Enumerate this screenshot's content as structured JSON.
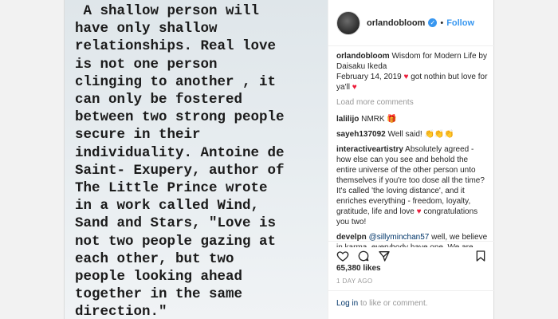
{
  "quote_lines": [
    " A shallow person will",
    "have only shallow",
    "relationships. Real love",
    "is not one person",
    "clinging to another , it",
    "can only be fostered",
    "between two strong people",
    "secure in their",
    "individuality. Antoine de",
    "Saint- Exupery, author of",
    "The Little Prince wrote",
    "in a work called Wind,",
    "Sand and Stars, \"Love is",
    "not two people gazing at",
    "each other, but two",
    "people looking ahead",
    "together in the same",
    "direction.\""
  ],
  "header": {
    "username": "orlandobloom",
    "verified_mark": "✓",
    "separator": "•",
    "follow": "Follow"
  },
  "caption": {
    "username": "orlandobloom",
    "line1": "Wisdom for Modern Life by Daisaku Ikeda",
    "line2": "February 14, 2019",
    "line2b": "got nothin but love for ya'll",
    "heart": "♥"
  },
  "load_more": "Load more comments",
  "comments": [
    {
      "user": "lalilijo",
      "text": "NMRK",
      "emoji": "🎁"
    },
    {
      "user": "sayeh137092",
      "text": "Well said!",
      "emoji": "👏👏👏"
    },
    {
      "user": "interactiveartistry",
      "text": "Absolutely agreed - how else can you see and behold the entire universe of the other person unto themselves if you're too dose all the time? It's called 'the loving distance', and it enriches everything - freedom, loyalty, gratitude, life and love",
      "text2": "congratulations you two!"
    },
    {
      "user": "develpn",
      "mention": "@sillyminchan57",
      "text": "well, we believe in karma, everybody have one. We are responsible of all around us. No matters"
    }
  ],
  "likes": "65,380 likes",
  "date": "1 DAY AGO",
  "login_link": "Log in",
  "login_text": " to like or comment.",
  "icons": {
    "heart": "heart-icon",
    "comment": "comment-icon",
    "share": "share-icon",
    "bookmark": "bookmark-icon"
  },
  "colors": {
    "accent": "#3897f0",
    "heart": "#ed1c3a",
    "muted": "#999999"
  }
}
